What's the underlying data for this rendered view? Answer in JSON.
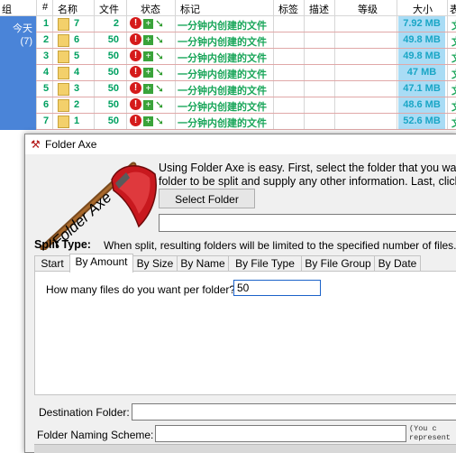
{
  "list": {
    "headers": {
      "group": "组",
      "index": "#",
      "name": "名称",
      "files": "文件",
      "status": "状态",
      "mark": "标记",
      "tag": "标签",
      "desc": "描述",
      "level": "等级",
      "size": "大小",
      "tail": "表"
    },
    "group": {
      "label": "今天",
      "count": "(7)"
    },
    "rows": [
      {
        "index": "1",
        "name": "7",
        "files": "2",
        "desc": "一分钟内创建的文件",
        "size": "7.92 MB",
        "tail": "文"
      },
      {
        "index": "2",
        "name": "6",
        "files": "50",
        "desc": "一分钟内创建的文件",
        "size": "49.8 MB",
        "tail": "文"
      },
      {
        "index": "3",
        "name": "5",
        "files": "50",
        "desc": "一分钟内创建的文件",
        "size": "49.8 MB",
        "tail": "文"
      },
      {
        "index": "4",
        "name": "4",
        "files": "50",
        "desc": "一分钟内创建的文件",
        "size": "47 MB",
        "tail": "文"
      },
      {
        "index": "5",
        "name": "3",
        "files": "50",
        "desc": "一分钟内创建的文件",
        "size": "47.1 MB",
        "tail": "文"
      },
      {
        "index": "6",
        "name": "2",
        "files": "50",
        "desc": "一分钟内创建的文件",
        "size": "48.6 MB",
        "tail": "文"
      },
      {
        "index": "7",
        "name": "1",
        "files": "50",
        "desc": "一分钟内创建的文件",
        "size": "52.6 MB",
        "tail": "文"
      }
    ]
  },
  "dialog": {
    "title": "Folder Axe",
    "logo_text": "Folder Axe",
    "intro_line1": "Using Folder Axe is easy. First, select the folder that you want",
    "intro_line2": "folder to be split and supply any other information. Last, click",
    "select_button": "Select Folder",
    "folder_path": "",
    "split_type_label": "Split Type:",
    "split_desc": "When split, resulting folders will be limited to the specified number of files.",
    "tabs": [
      "Start",
      "By Amount",
      "By Size",
      "By Name",
      "By File Type",
      "By File Group",
      "By Date"
    ],
    "active_tab": "By Amount",
    "per_folder_label": "How many files do you want per folder?",
    "per_folder_value": "50",
    "destination_label": "Destination Folder:",
    "destination_value": "",
    "naming_label": "Folder Naming Scheme:",
    "naming_value": "",
    "hint_line1": "(You c",
    "hint_line2": "represent"
  },
  "colors": {
    "group_bg": "#4a84d8",
    "size_bg": "#a9dcf5",
    "accent": "#1b62c9",
    "axe_red": "#c8181e"
  }
}
